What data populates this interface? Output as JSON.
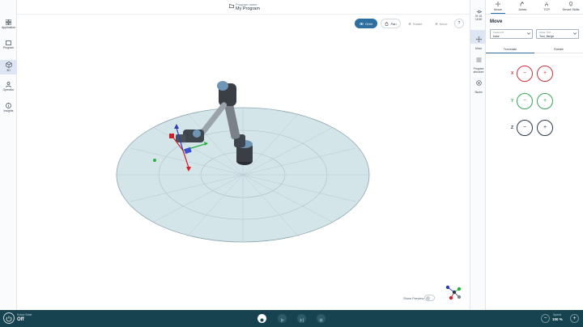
{
  "left_nav": {
    "items": [
      {
        "label": "Application",
        "icon": "grid-icon",
        "active": false
      },
      {
        "label": "Program",
        "icon": "folder-icon",
        "active": false
      },
      {
        "label": "3D",
        "icon": "cube-icon",
        "active": true
      },
      {
        "label": "Operator",
        "icon": "person-icon",
        "active": false
      },
      {
        "label": "Insights",
        "icon": "info-icon",
        "active": false
      }
    ]
  },
  "header": {
    "program_sub": "Program name",
    "program_name": "My Program"
  },
  "view_toolbar": {
    "orbit": "Orbit",
    "pan": "Pan",
    "rotate": "Rotate",
    "move": "Move",
    "help": "?"
  },
  "show_preview": {
    "label": "Show Preview",
    "enabled": false
  },
  "right_strip": {
    "time": "9f: 15\n15:36",
    "items": [
      {
        "label": "Move",
        "icon": "move-icon",
        "active": true
      },
      {
        "label": "Program structure",
        "icon": "list-icon",
        "active": false
      },
      {
        "label": "Studio",
        "icon": "studio-icon",
        "active": false
      }
    ]
  },
  "panel": {
    "tabs": [
      {
        "label": "Move",
        "icon": "move-cross-icon",
        "active": true
      },
      {
        "label": "Joints",
        "icon": "joints-icon",
        "active": false
      },
      {
        "label": "TCP",
        "icon": "tcp-icon",
        "active": false
      },
      {
        "label": "Smart Skills",
        "icon": "skills-icon",
        "active": false
      }
    ],
    "title": "Move",
    "feature_select": {
      "label": "Feature ID",
      "value": "base"
    },
    "active_tcp_select": {
      "label": "Active TCP",
      "value": "Tool_flange"
    },
    "sub_tabs": [
      "Translate",
      "Rotate"
    ],
    "active_sub_tab": "Translate",
    "axes": [
      {
        "name": "X",
        "color": "#c9333f"
      },
      {
        "name": "Y",
        "color": "#3aa55b"
      },
      {
        "name": "Z",
        "color": "#2a3a48"
      }
    ],
    "minus": "−",
    "plus": "+"
  },
  "bottom_bar": {
    "robot_state_label": "Robot State",
    "robot_state_value": "Off",
    "speed_label": "Speed",
    "speed_value": "100 %",
    "minus": "−",
    "plus": "+"
  }
}
